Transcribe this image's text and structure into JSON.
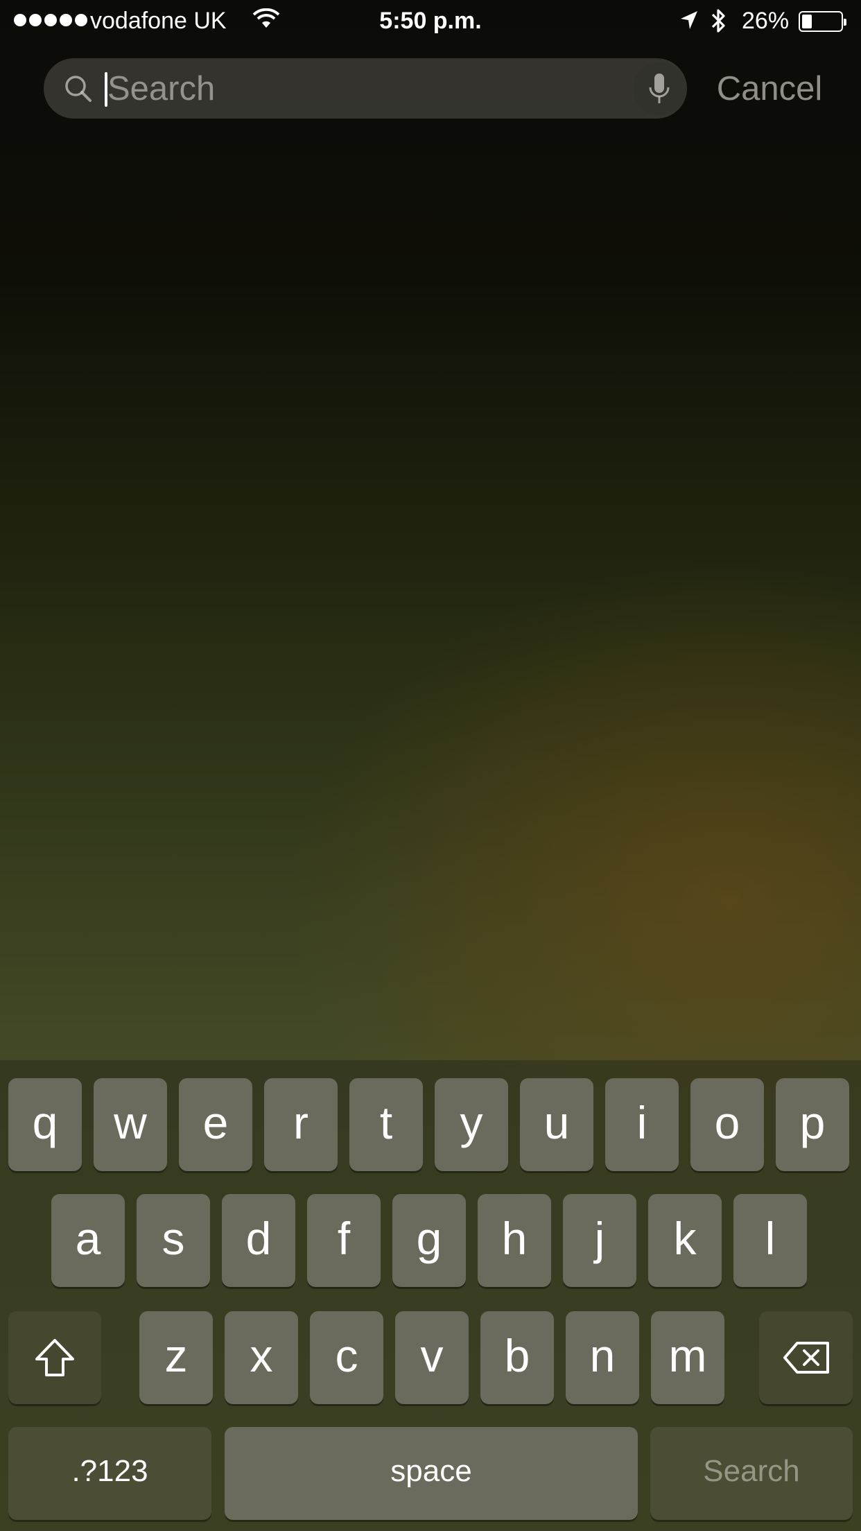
{
  "status_bar": {
    "carrier": "vodafone UK",
    "time": "5:50 p.m.",
    "battery_percent": "26%",
    "battery_level": 0.26,
    "icons": [
      "signal-dots-icon",
      "wifi-icon",
      "location-arrow-icon",
      "bluetooth-icon",
      "battery-icon"
    ]
  },
  "search": {
    "placeholder": "Search",
    "value": "",
    "cancel_label": "Cancel"
  },
  "keyboard": {
    "row1": [
      "q",
      "w",
      "e",
      "r",
      "t",
      "y",
      "u",
      "i",
      "o",
      "p"
    ],
    "row2": [
      "a",
      "s",
      "d",
      "f",
      "g",
      "h",
      "j",
      "k",
      "l"
    ],
    "row3": [
      "z",
      "x",
      "c",
      "v",
      "b",
      "n",
      "m"
    ],
    "numbers_label": ".?123",
    "space_label": "space",
    "return_label": "Search"
  },
  "colors": {
    "key_bg": "#6b6b5d",
    "special_key_bg": "#46472f",
    "text": "#ffffff"
  }
}
